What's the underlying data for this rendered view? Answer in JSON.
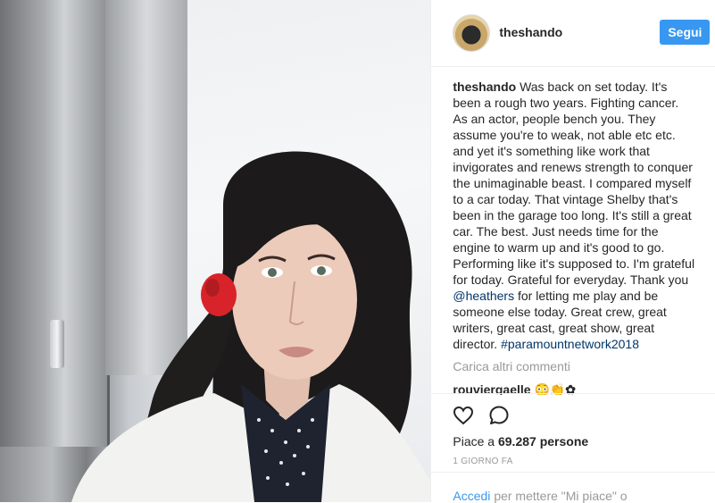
{
  "post": {
    "username": "theshando",
    "follow_label": "Segui",
    "caption": {
      "username": "theshando",
      "text_before_mention": "Was back on set today. It's been a rough two years. Fighting cancer. As an actor, people bench you. They assume you're to weak, not able etc etc. and yet it's something like work that invigorates and renews strength to conquer the unimaginable beast. I compared myself to a car today. That vintage Shelby that's been in the garage too long. It's still a great car. The best. Just needs time for the engine to warm up and it's good to go. Performing like it's supposed to. I'm grateful for today. Grateful for everyday. Thank you",
      "mention": "@heathers",
      "text_after_mention": "for letting me play and be someone else today. Great crew, great writers, great cast, great show, great director.",
      "hashtag": "#paramountnetwork2018"
    },
    "load_more_comments": "Carica altri commenti",
    "comment_preview": {
      "username": "rouviergaelle",
      "text": "😳👏✿"
    },
    "likes_prefix": "Piace a",
    "likes_count": "69.287 persone",
    "timestamp": "1 GIORNO FA",
    "login_prompt": {
      "link": "Accedi",
      "text": "per mettere \"Mi piace\" o"
    }
  },
  "colors": {
    "follow_button": "#3897f0",
    "link": "#003569",
    "muted": "#999999",
    "scrunchie": "#d8232a"
  },
  "icons": [
    "heart-icon",
    "comment-icon"
  ]
}
